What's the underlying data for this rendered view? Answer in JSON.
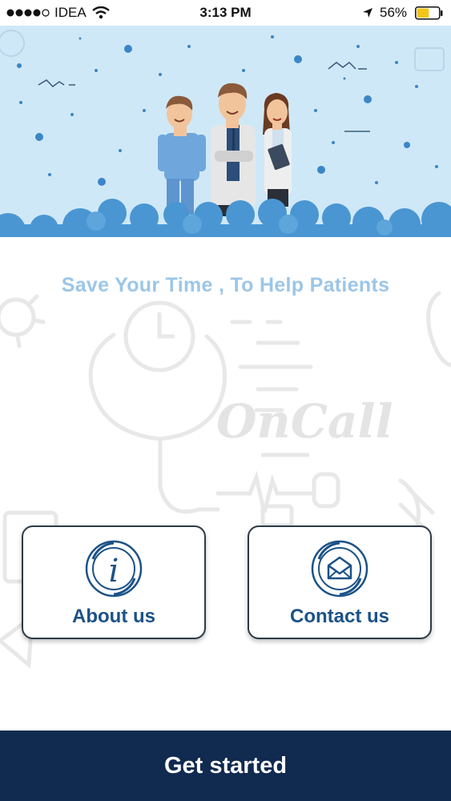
{
  "status_bar": {
    "carrier": "IDEA",
    "time": "3:13 PM",
    "battery": "56%",
    "battery_level": 0.56,
    "icons": [
      "signal-dots-icon",
      "wifi-icon",
      "location-arrow-icon",
      "battery-icon"
    ]
  },
  "tagline": "Save Your Time , To Help Patients",
  "logo": {
    "text": "OnCall"
  },
  "cards": {
    "about": {
      "label": "About us",
      "icon": "info-icon"
    },
    "contact": {
      "label": "Contact us",
      "icon": "envelope-icon"
    }
  },
  "cta": {
    "label": "Get started"
  },
  "colors": {
    "hero_bg": "#cfe8f7",
    "cloud": "#4a96d2",
    "accent": "#1c5287",
    "tagline": "#9cc6e8",
    "button_bg": "#102a50",
    "card_border": "#2d3a48"
  }
}
